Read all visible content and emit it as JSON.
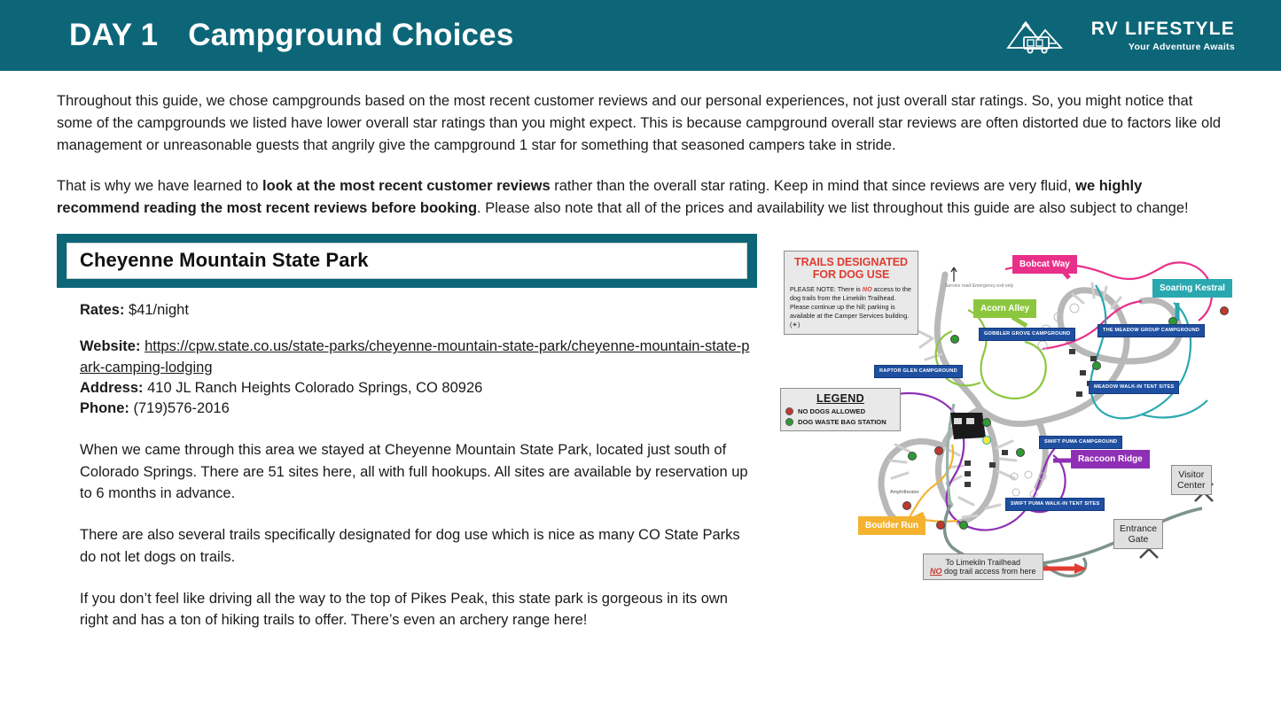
{
  "header": {
    "day_label": "DAY 1",
    "title": "Campground Choices",
    "logo": {
      "name": "RV LIFESTYLE",
      "tagline": "Your Adventure Awaits",
      "icon": "rv-mountain-logo-icon"
    },
    "background_color": "#0c6678"
  },
  "intro": {
    "paragraph1": "Throughout this guide, we chose campgrounds based on the most recent customer reviews and our personal experiences, not just overall star ratings. So, you might notice that some of the campgrounds we listed have lower overall star ratings than you might expect. This is because campground overall star reviews are often distorted due to factors like old management or unreasonable guests that angrily give the campground 1 star for something that seasoned campers take in stride.",
    "paragraph2_part1": "That is why we have learned to ",
    "paragraph2_bold1": "look at the most recent customer reviews",
    "paragraph2_part2": " rather than the overall star rating. Keep in mind that since reviews are very fluid, ",
    "paragraph2_bold2": "we highly recommend reading the most recent reviews before booking",
    "paragraph2_part3": ". Please also note that all of the prices and availability we list throughout this guide are also subject to change!"
  },
  "campground": {
    "name": "Cheyenne Mountain State Park",
    "rates_label": "Rates:",
    "rates_value": " $41/night",
    "website_label": "Website:",
    "website_url": "https://cpw.state.co.us/state-parks/cheyenne-mountain-state-park/cheyenne-mountain-state-park-camping-lodging",
    "address_label": "Address:",
    "address_value": " 410 JL Ranch Heights Colorado Springs, CO 80926",
    "phone_label": "Phone:",
    "phone_value": " (719)576-2016",
    "description1": "When we came through this area we stayed at Cheyenne Mountain State Park, located just south of Colorado Springs. There are 51 sites here, all with full hookups. All sites are available by reservation up to 6 months in advance.",
    "description2": "There are also several trails specifically designated for dog use which is nice as many CO State Parks do not let dogs on trails.",
    "description3": "If you don’t feel like driving all the way to the top of Pikes Peak, this state park is gorgeous in its own right and has a ton of hiking trails to offer. There’s even an archery range here!"
  },
  "map": {
    "alt_name": "cheyenne-mountain-state-park-dog-trails-map",
    "notice": {
      "title_line1": "TRAILS DESIGNATED",
      "title_line2": "FOR DOG USE",
      "body_pre": "PLEASE NOTE:  There is ",
      "body_no": "NO",
      "body_post": " access to the dog trails from the Limekiln Trailhead.  Please continue up the hill; parking is available at the Camper Services building. (☀)"
    },
    "legend": {
      "title": "LEGEND",
      "items": [
        {
          "label": "NO DOGS ALLOWED",
          "color": "#c0392b"
        },
        {
          "label": "DOG WASTE BAG STATION",
          "color": "#2e9b32"
        }
      ]
    },
    "trail_labels": [
      {
        "name": "Bobcat Way",
        "color": "#e8308a"
      },
      {
        "name": "Acorn Alley",
        "color": "#8cc63e"
      },
      {
        "name": "Soaring Kestral",
        "color": "#2aa8b0"
      },
      {
        "name": "Raccoon Ridge",
        "color": "#8e2fb5"
      },
      {
        "name": "Boulder Run",
        "color": "#f4b230"
      }
    ],
    "campground_labels": [
      "GOBBLER GROVE CAMPGROUND",
      "THE MEADOW GROUP CAMPGROUND",
      "RAPTOR GLEN CAMPGROUND",
      "MEADOW WALK-IN TENT SITES",
      "SWIFT PUMA CAMPGROUND",
      "SWIFT PUMA WALK-IN TENT SITES"
    ],
    "facility_labels": {
      "visitor_center": "Visitor\nCenter",
      "visitor_center_line1": "Visitor",
      "visitor_center_line2": "Center",
      "entrance_gate_line1": "Entrance",
      "entrance_gate_line2": "Gate",
      "amphitheater": "Amphitheater",
      "service_road": "Service road\nEmergency exit only"
    },
    "limekiln_callout": {
      "line1": "To Limekiln Trailhead",
      "no": "NO",
      "line2_rest": " dog trail access from here"
    }
  }
}
